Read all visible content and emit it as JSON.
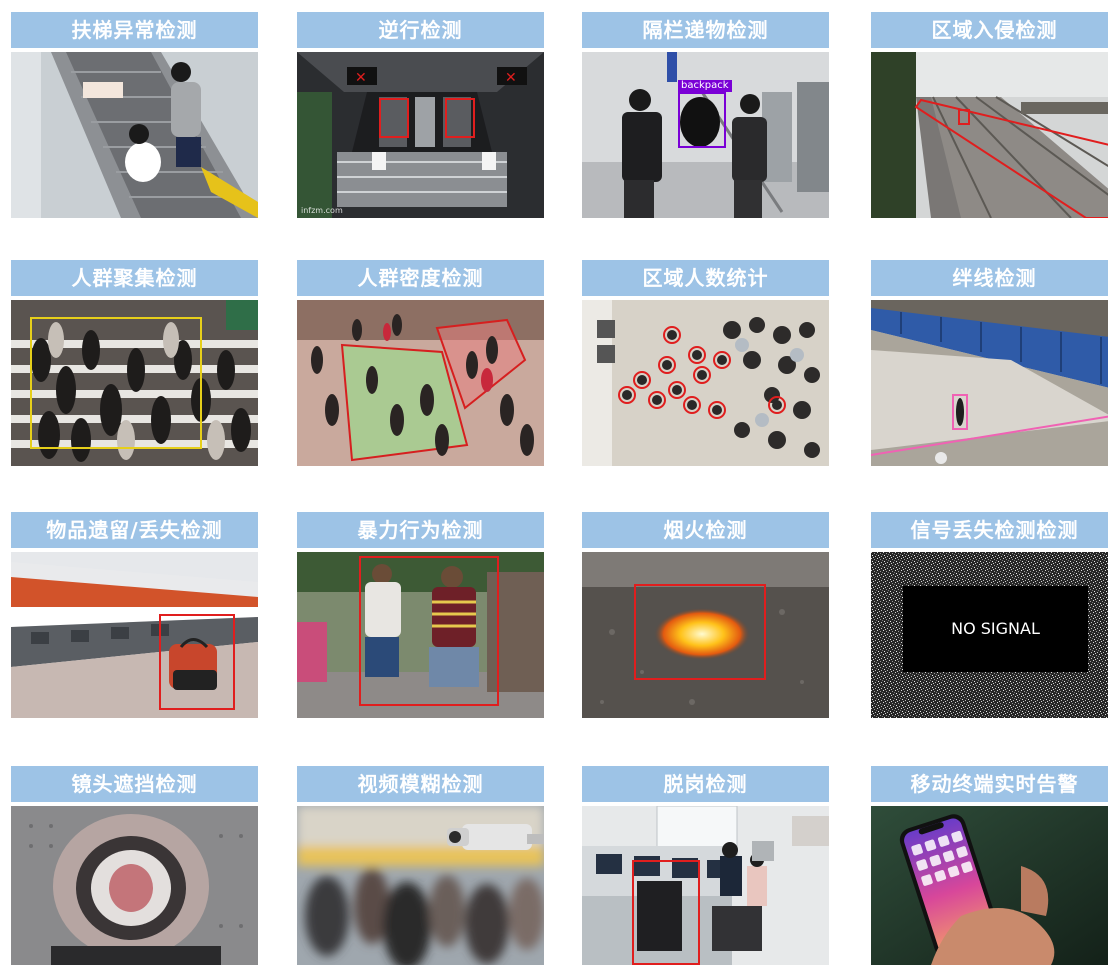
{
  "tiles": [
    {
      "label": "扶梯异常检测",
      "icon": "escalator-photo"
    },
    {
      "label": "逆行检测",
      "icon": "subway-gate-photo",
      "watermark": "infzm.com"
    },
    {
      "label": "隔栏递物检测",
      "icon": "backpack-handover-photo",
      "detection_tag": "backpack"
    },
    {
      "label": "区域入侵检测",
      "icon": "railway-track-photo"
    },
    {
      "label": "人群聚集检测",
      "icon": "crowd-crosswalk-photo"
    },
    {
      "label": "人群密度检测",
      "icon": "crowd-station-photo"
    },
    {
      "label": "区域人数统计",
      "icon": "overhead-crowd-photo"
    },
    {
      "label": "绊线检测",
      "icon": "tripwire-yard-photo"
    },
    {
      "label": "物品遗留/丢失检测",
      "icon": "left-luggage-photo"
    },
    {
      "label": "暴力行为检测",
      "icon": "fight-photo"
    },
    {
      "label": "烟火检测",
      "icon": "fire-photo"
    },
    {
      "label": "信号丢失检测检测",
      "icon": "no-signal-screen",
      "overlay_text": "NO SIGNAL"
    },
    {
      "label": "镜头遮挡检测",
      "icon": "covered-camera-photo"
    },
    {
      "label": "视频模糊检测",
      "icon": "blurred-video-photo"
    },
    {
      "label": "脱岗检测",
      "icon": "empty-desk-photo"
    },
    {
      "label": "移动终端实时告警",
      "icon": "smartphone-photo"
    }
  ],
  "colors": {
    "label_bg": "#9dc3e6",
    "label_text": "#ffffff",
    "detection_box": "#e01e1e",
    "tag_bg": "#7a00d6"
  }
}
